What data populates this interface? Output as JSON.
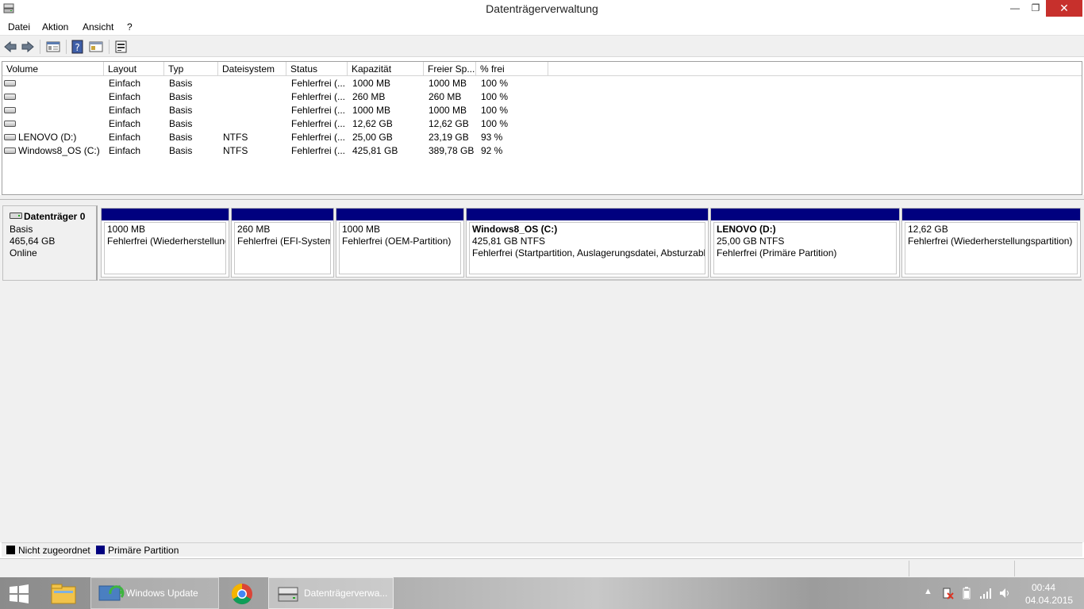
{
  "window": {
    "title": "Datenträgerverwaltung",
    "close_glyph": "✕",
    "minimize_glyph": "—",
    "maximize_glyph": "❐"
  },
  "menu": [
    "Datei",
    "Aktion",
    "Ansicht",
    "?"
  ],
  "toolbar": {
    "icons": [
      "back-arrow-icon",
      "forward-arrow-icon",
      "properties-icon",
      "help-icon",
      "show-hide-tree-icon",
      "settings-icon"
    ]
  },
  "volume_list": {
    "columns": [
      "Volume",
      "Layout",
      "Typ",
      "Dateisystem",
      "Status",
      "Kapazität",
      "Freier Sp...",
      "% frei"
    ],
    "rows": [
      {
        "volume": "",
        "layout": "Einfach",
        "typ": "Basis",
        "fs": "",
        "status": "Fehlerfrei (...",
        "capacity": "1000 MB",
        "free": "1000 MB",
        "pct": "100 %"
      },
      {
        "volume": "",
        "layout": "Einfach",
        "typ": "Basis",
        "fs": "",
        "status": "Fehlerfrei (...",
        "capacity": "260 MB",
        "free": "260 MB",
        "pct": "100 %"
      },
      {
        "volume": "",
        "layout": "Einfach",
        "typ": "Basis",
        "fs": "",
        "status": "Fehlerfrei (...",
        "capacity": "1000 MB",
        "free": "1000 MB",
        "pct": "100 %"
      },
      {
        "volume": "",
        "layout": "Einfach",
        "typ": "Basis",
        "fs": "",
        "status": "Fehlerfrei (...",
        "capacity": "12,62 GB",
        "free": "12,62 GB",
        "pct": "100 %"
      },
      {
        "volume": "LENOVO (D:)",
        "layout": "Einfach",
        "typ": "Basis",
        "fs": "NTFS",
        "status": "Fehlerfrei (...",
        "capacity": "25,00 GB",
        "free": "23,19 GB",
        "pct": "93 %"
      },
      {
        "volume": "Windows8_OS (C:)",
        "layout": "Einfach",
        "typ": "Basis",
        "fs": "NTFS",
        "status": "Fehlerfrei (...",
        "capacity": "425,81 GB",
        "free": "389,78 GB",
        "pct": "92 %"
      }
    ]
  },
  "disk": {
    "name": "Datenträger 0",
    "type": "Basis",
    "size": "465,64 GB",
    "state": "Online",
    "partitions": [
      {
        "name": "",
        "size": "1000 MB",
        "status": "Fehlerfrei (Wiederherstellungspartition)"
      },
      {
        "name": "",
        "size": "260 MB",
        "status": "Fehlerfrei (EFI-Systempartition)"
      },
      {
        "name": "",
        "size": "1000 MB",
        "status": "Fehlerfrei (OEM-Partition)"
      },
      {
        "name": "Windows8_OS  (C:)",
        "size": "425,81 GB NTFS",
        "status": "Fehlerfrei (Startpartition, Auslagerungsdatei, Absturzabbild, Primäre Partition)"
      },
      {
        "name": "LENOVO  (D:)",
        "size": "25,00 GB NTFS",
        "status": "Fehlerfrei (Primäre Partition)"
      },
      {
        "name": "",
        "size": "12,62 GB",
        "status": "Fehlerfrei (Wiederherstellungspartition)"
      }
    ]
  },
  "legend": [
    {
      "label": "Nicht zugeordnet",
      "color": "#000000"
    },
    {
      "label": "Primäre Partition",
      "color": "#00007f"
    }
  ],
  "colors": {
    "primary_partition": "#00007f",
    "close_button": "#c7302c"
  },
  "taskbar": {
    "tasks": [
      {
        "label": "",
        "icon": "windows-start-icon"
      },
      {
        "label": "",
        "icon": "file-explorer-icon"
      },
      {
        "label": "Windows Update",
        "icon": "windows-update-icon"
      },
      {
        "label": "",
        "icon": "chrome-icon"
      },
      {
        "label": "Datenträgerverwa...",
        "icon": "disk-management-icon"
      }
    ],
    "tray_icons": [
      "show-hidden-icons-icon",
      "action-center-icon",
      "battery-icon",
      "network-signal-icon",
      "volume-icon"
    ],
    "time": "00:44",
    "date": "04.04.2015"
  }
}
